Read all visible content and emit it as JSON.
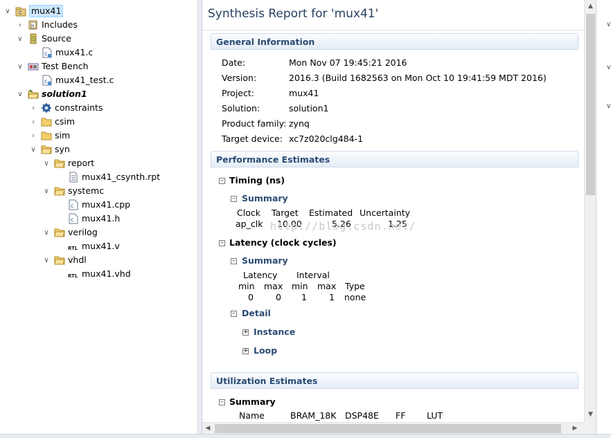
{
  "tree": {
    "project": "mux41",
    "includes": "Includes",
    "source": "Source",
    "source_file": "mux41.c",
    "testbench": "Test Bench",
    "testbench_file": "mux41_test.c",
    "solution": "solution1",
    "constraints": "constraints",
    "csim": "csim",
    "sim": "sim",
    "syn": "syn",
    "report": "report",
    "report_file": "mux41_csynth.rpt",
    "systemc": "systemc",
    "systemc_cpp": "mux41.cpp",
    "systemc_h": "mux41.h",
    "verilog": "verilog",
    "verilog_file": "mux41.v",
    "vhdl": "vhdl",
    "vhdl_file": "mux41.vhd"
  },
  "report": {
    "title": "Synthesis Report for 'mux41'",
    "general": {
      "heading": "General Information",
      "date_label": "Date:",
      "date": "Mon Nov 07 19:45:21 2016",
      "version_label": "Version:",
      "version": "2016.3 (Build 1682563 on Mon Oct 10 19:41:59 MDT 2016)",
      "project_label": "Project:",
      "project": "mux41",
      "solution_label": "Solution:",
      "solution": "solution1",
      "family_label": "Product family:",
      "family": "zynq",
      "device_label": "Target device:",
      "device": "xc7z020clg484-1"
    },
    "performance": {
      "heading": "Performance Estimates",
      "timing": "Timing (ns)",
      "summary": "Summary",
      "timing_headers": [
        "Clock",
        "Target",
        "Estimated",
        "Uncertainty"
      ],
      "timing_row": [
        "ap_clk",
        "10.00",
        "5.26",
        "1.25"
      ],
      "latency": "Latency (clock cycles)",
      "latency_summary": "Summary",
      "latency_group_latency": "Latency",
      "latency_group_interval": "Interval",
      "latency_subheaders": [
        "min",
        "max",
        "min",
        "max",
        "Type"
      ],
      "latency_row": [
        "0",
        "0",
        "1",
        "1",
        "none"
      ],
      "detail": "Detail",
      "instance": "Instance",
      "loop": "Loop"
    },
    "utilization": {
      "heading": "Utilization Estimates",
      "summary": "Summary",
      "headers": [
        "Name",
        "BRAM_18K",
        "DSP48E",
        "FF",
        "LUT"
      ]
    }
  },
  "watermark": "http://blog.csdn.net/"
}
